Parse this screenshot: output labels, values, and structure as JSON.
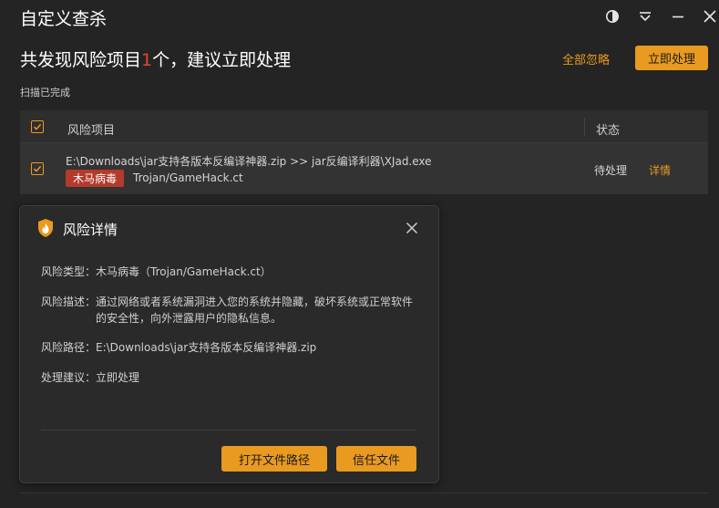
{
  "window": {
    "title": "自定义查杀",
    "controls": [
      "theme-icon",
      "dropdown-icon",
      "minimize-icon",
      "close-icon"
    ]
  },
  "summary": {
    "headline_prefix": "共发现风险项目",
    "risk_count": "1",
    "headline_suffix": "个，建议立即处理",
    "ignore_all_label": "全部忽略",
    "process_now_label": "立即处理",
    "scan_status": "扫描已完成"
  },
  "table": {
    "headers": {
      "item": "风险项目",
      "status": "状态"
    },
    "rows": [
      {
        "path": "E:\\Downloads\\jar支持各版本反编译神器.zip >> jar反编译利器\\XJad.exe",
        "threat_badge": "木马病毒",
        "threat_name": "Trojan/GameHack.ct",
        "status": "待处理",
        "detail_label": "详情",
        "checked": true
      }
    ]
  },
  "dialog": {
    "title": "风险详情",
    "icon": "flame-shield-icon",
    "fields": {
      "type_label": "风险类型：",
      "type_value": "木马病毒（Trojan/GameHack.ct）",
      "desc_label": "风险描述：",
      "desc_value": "通过网络或者系统漏洞进入您的系统并隐藏，破坏系统或正常软件的安全性，向外泄露用户的隐私信息。",
      "path_label": "风险路径：",
      "path_value": "E:\\Downloads\\jar支持各版本反编译神器.zip",
      "advice_label": "处理建议：",
      "advice_value": "立即处理"
    },
    "open_path_label": "打开文件路径",
    "trust_file_label": "信任文件"
  },
  "colors": {
    "accent": "#e99a20",
    "danger": "#e8452b",
    "badge": "#b43a2b",
    "background": "#242424"
  }
}
